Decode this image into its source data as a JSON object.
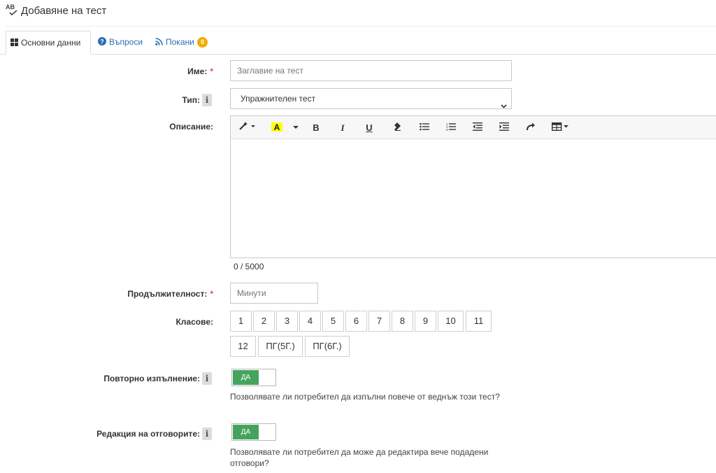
{
  "page": {
    "title": "Добавяне на тест",
    "title_icon": "spellcheck-icon"
  },
  "tabs": [
    {
      "label": "Основни данни",
      "icon": "grid-icon"
    },
    {
      "label": "Въпроси",
      "icon": "question-circle-icon"
    },
    {
      "label": "Покани",
      "icon": "rss-icon",
      "badge": "0"
    }
  ],
  "form": {
    "name": {
      "label": "Име:",
      "required": "*",
      "placeholder": "Заглавие на тест",
      "value": ""
    },
    "type": {
      "label": "Тип:",
      "info": "i",
      "selected": "Упражнителен тест"
    },
    "description": {
      "label": "Описание:",
      "counter": "0 / 5000"
    },
    "duration": {
      "label": "Продължителност:",
      "required": "*",
      "placeholder": "Минути"
    },
    "grades": {
      "label": "Класове:",
      "row1": [
        "1",
        "2",
        "3",
        "4",
        "5",
        "6",
        "7",
        "8",
        "9",
        "10",
        "11"
      ],
      "row2": [
        "12",
        "ПГ(5Г.)",
        "ПГ(6Г.)"
      ]
    },
    "retake": {
      "label": "Повторно изпълнение:",
      "info": "i",
      "toggle": "ДА",
      "help": "Позволявате ли потребител да изпълни повече от веднъж този тест?"
    },
    "edit_answers": {
      "label": "Редакция на отговорите:",
      "info": "i",
      "toggle": "ДА",
      "help": "Позволявате ли потребител да може да редактира вече подадени отговори?"
    }
  },
  "toolbar": {
    "buttons": [
      "magic-icon",
      "highlight-color-icon",
      "bold-icon",
      "italic-icon",
      "underline-icon",
      "eraser-icon",
      "unordered-list-icon",
      "ordered-list-icon",
      "outdent-icon",
      "indent-icon",
      "redo-icon",
      "table-icon"
    ],
    "highlight_color": "#ffff00"
  },
  "colors": {
    "accent": "#2a6db5",
    "toggle_on": "#46a35e",
    "badge": "#f0ad00",
    "required": "#d9534f"
  }
}
